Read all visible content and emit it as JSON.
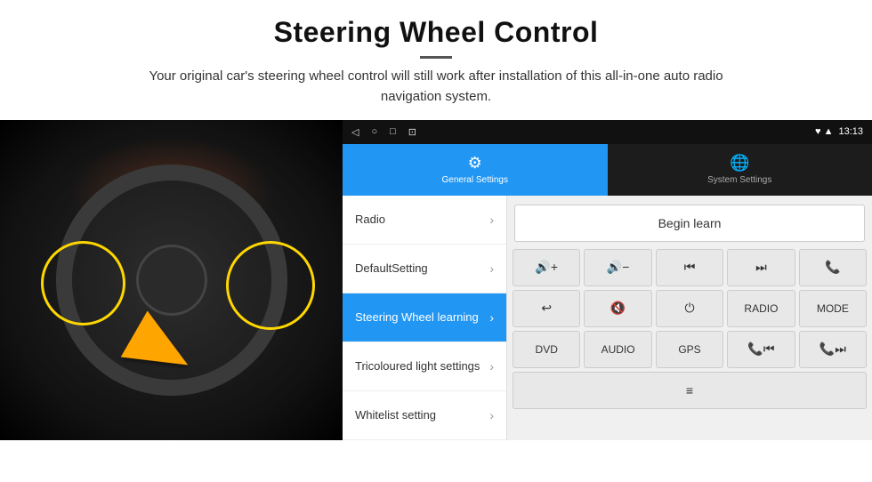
{
  "header": {
    "title": "Steering Wheel Control",
    "subtitle": "Your original car's steering wheel control will still work after installation of this all-in-one auto radio navigation system."
  },
  "statusBar": {
    "icons": [
      "◁",
      "○",
      "□",
      "⊡"
    ],
    "rightIcons": "♥ ▲",
    "time": "13:13"
  },
  "tabs": [
    {
      "id": "general",
      "label": "General Settings",
      "icon": "⚙",
      "active": true
    },
    {
      "id": "system",
      "label": "System Settings",
      "icon": "🌐",
      "active": false
    }
  ],
  "menu": [
    {
      "id": "radio",
      "label": "Radio",
      "active": false
    },
    {
      "id": "default",
      "label": "DefaultSetting",
      "active": false
    },
    {
      "id": "steering",
      "label": "Steering Wheel learning",
      "active": true
    },
    {
      "id": "tricoloured",
      "label": "Tricoloured light settings",
      "active": false
    },
    {
      "id": "whitelist",
      "label": "Whitelist setting",
      "active": false
    }
  ],
  "buttons": {
    "begin_learn": "Begin learn",
    "row1": [
      {
        "label": "🔊+",
        "id": "vol-up"
      },
      {
        "label": "🔊−",
        "id": "vol-down"
      },
      {
        "label": "⏮",
        "id": "prev"
      },
      {
        "label": "⏭",
        "id": "next"
      },
      {
        "label": "📞",
        "id": "call"
      }
    ],
    "row2": [
      {
        "label": "↩",
        "id": "back"
      },
      {
        "label": "🔊✕",
        "id": "mute"
      },
      {
        "label": "⏻",
        "id": "power"
      },
      {
        "label": "RADIO",
        "id": "radio"
      },
      {
        "label": "MODE",
        "id": "mode"
      }
    ],
    "row3": [
      {
        "label": "DVD",
        "id": "dvd"
      },
      {
        "label": "AUDIO",
        "id": "audio"
      },
      {
        "label": "GPS",
        "id": "gps"
      },
      {
        "label": "📞⏮",
        "id": "tel-prev"
      },
      {
        "label": "📞⏭",
        "id": "tel-next"
      }
    ],
    "row4": [
      {
        "label": "≡",
        "id": "menu-icon"
      }
    ]
  }
}
